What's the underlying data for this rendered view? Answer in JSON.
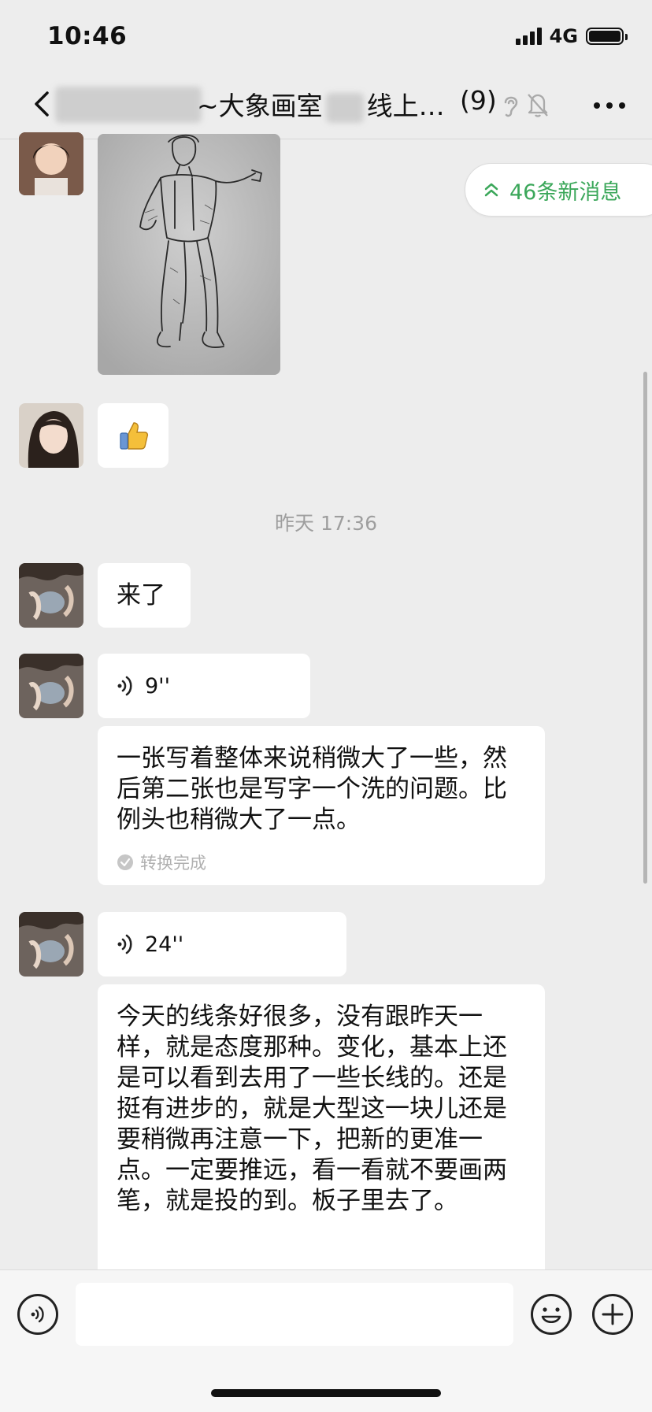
{
  "status": {
    "time": "10:46",
    "network": "4G"
  },
  "header": {
    "title_tilde": "~大象画室",
    "title_rest": "线上…",
    "member_count": "(9)"
  },
  "new_messages": {
    "label": "46条新消息"
  },
  "chat": {
    "time_divider": "昨天 17:36",
    "msg_1": {
      "text": "来了"
    },
    "voice_1": {
      "duration": "9''",
      "transcript": "一张写着整体来说稍微大了一些，然后第二张也是写字一个洗的问题。比例头也稍微大了一点。",
      "status": "转换完成"
    },
    "voice_2": {
      "duration": "24''",
      "transcript": "今天的线条好很多，没有跟昨天一样，就是态度那种。变化，基本上还是可以看到去用了一些长线的。还是挺有进步的，就是大型这一块儿还是要稍微再注意一下，把新的更准一点。一定要推远，看一看就不要画两笔，就是投的到。板子里去了。"
    }
  },
  "input": {
    "placeholder": ""
  },
  "icons": {
    "back": "chevron-left-icon",
    "ear": "ear-icon",
    "mute": "bell-off-icon",
    "more": "more-icon",
    "voice": "voice-icon",
    "emoji": "emoji-icon",
    "plus": "plus-icon",
    "thumbs": "thumbs-up-icon",
    "check": "check-circle-icon",
    "double_up": "double-chevron-up-icon"
  },
  "colors": {
    "accent_green": "#3ba75a",
    "background": "#ededed",
    "bubble": "#ffffff",
    "secondary_text": "#9e9e9e"
  }
}
